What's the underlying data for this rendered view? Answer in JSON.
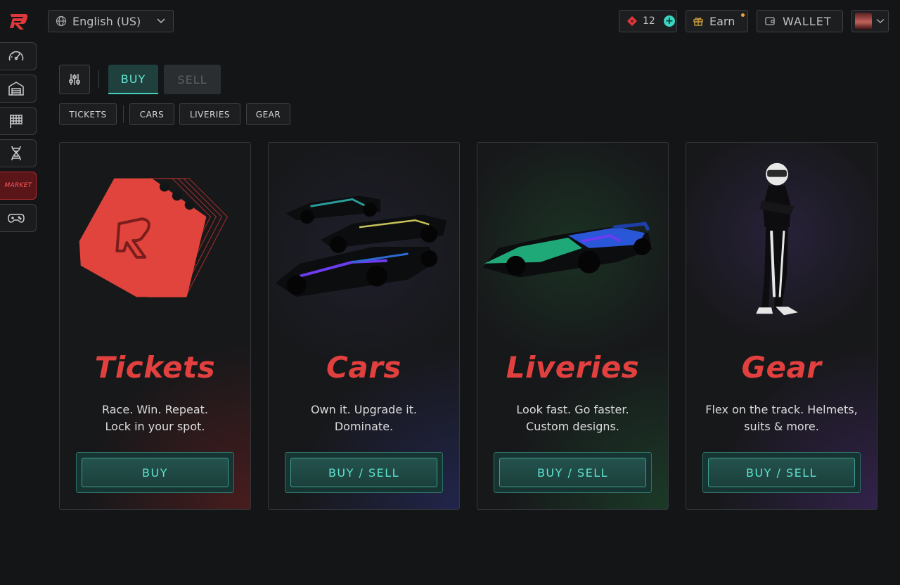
{
  "header": {
    "language": "English (US)",
    "tickets_count": "12",
    "earn_label": "Earn",
    "wallet_label": "WALLET"
  },
  "sidebar": {
    "items": [
      {
        "name": "dashboard"
      },
      {
        "name": "garage"
      },
      {
        "name": "races"
      },
      {
        "name": "dna"
      },
      {
        "name": "market",
        "label": "MARKET",
        "active": true
      },
      {
        "name": "games"
      }
    ]
  },
  "tabs": {
    "buy": "BUY",
    "sell": "SELL",
    "active": "BUY"
  },
  "chips": [
    "TICKETS",
    "CARS",
    "LIVERIES",
    "GEAR"
  ],
  "cards": [
    {
      "title": "Tickets",
      "line1": "Race. Win. Repeat.",
      "line2": "Lock in your spot.",
      "cta": "BUY"
    },
    {
      "title": "Cars",
      "line1": "Own it. Upgrade it.",
      "line2": "Dominate.",
      "cta": "BUY / SELL"
    },
    {
      "title": "Liveries",
      "line1": "Look fast. Go faster.",
      "line2": "Custom designs.",
      "cta": "BUY / SELL"
    },
    {
      "title": "Gear",
      "line1": "Flex on the track. Helmets,",
      "line2": "suits & more.",
      "cta": "BUY / SELL"
    }
  ],
  "colors": {
    "accent_teal": "#43d1bd",
    "brand_red": "#e2403f",
    "background": "#141517"
  }
}
